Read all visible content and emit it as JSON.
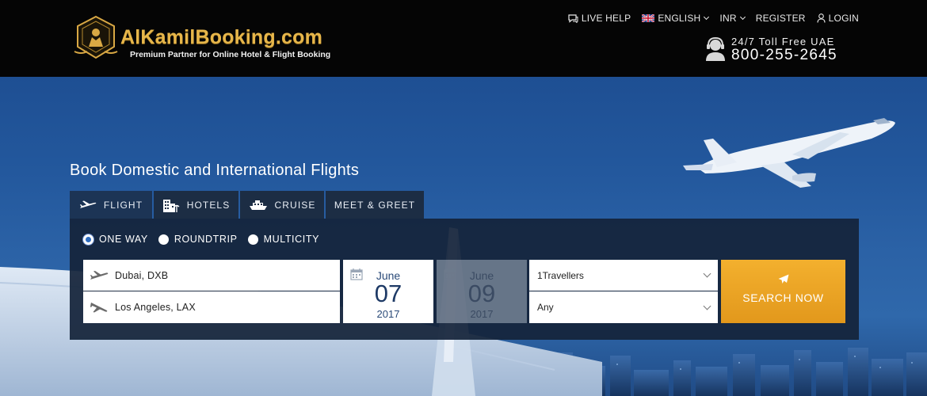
{
  "brand": {
    "name": "AlKamilBooking.com",
    "tagline": "Premium Partner for Online Hotel & Flight Booking"
  },
  "topnav": {
    "live_help": "LIVE HELP",
    "language": "ENGLISH",
    "currency": "INR",
    "register": "REGISTER",
    "login": "LOGIN"
  },
  "support": {
    "label": "24/7 Toll Free UAE",
    "phone": "800-255-2645"
  },
  "hero": {
    "title": "Book Domestic and International Flights"
  },
  "tabs": [
    {
      "label": "FLIGHT",
      "icon": "plane-icon",
      "active": true
    },
    {
      "label": "HOTELS",
      "icon": "hotel-icon",
      "active": false
    },
    {
      "label": "CRUISE",
      "icon": "ship-icon",
      "active": false
    },
    {
      "label": "MEET & GREET",
      "icon": "",
      "active": false
    }
  ],
  "trip_type": {
    "options": [
      "ONE WAY",
      "ROUNDTRIP",
      "MULTICITY"
    ],
    "selected": "ONE WAY"
  },
  "search": {
    "from": "Dubai, DXB",
    "to": "Los Angeles, LAX",
    "departure": {
      "month": "June",
      "day": "07",
      "year": "2017"
    },
    "return": {
      "month": "June",
      "day": "09",
      "year": "2017"
    },
    "travellers": "1Travellers",
    "class": "Any",
    "button_label": "SEARCH NOW"
  },
  "colors": {
    "header_bg": "#050505",
    "brand_gold": "#e7b64a",
    "accent_orange": "#f0a623",
    "panel_bg": "#14243a",
    "date_text": "#1e3a66"
  }
}
